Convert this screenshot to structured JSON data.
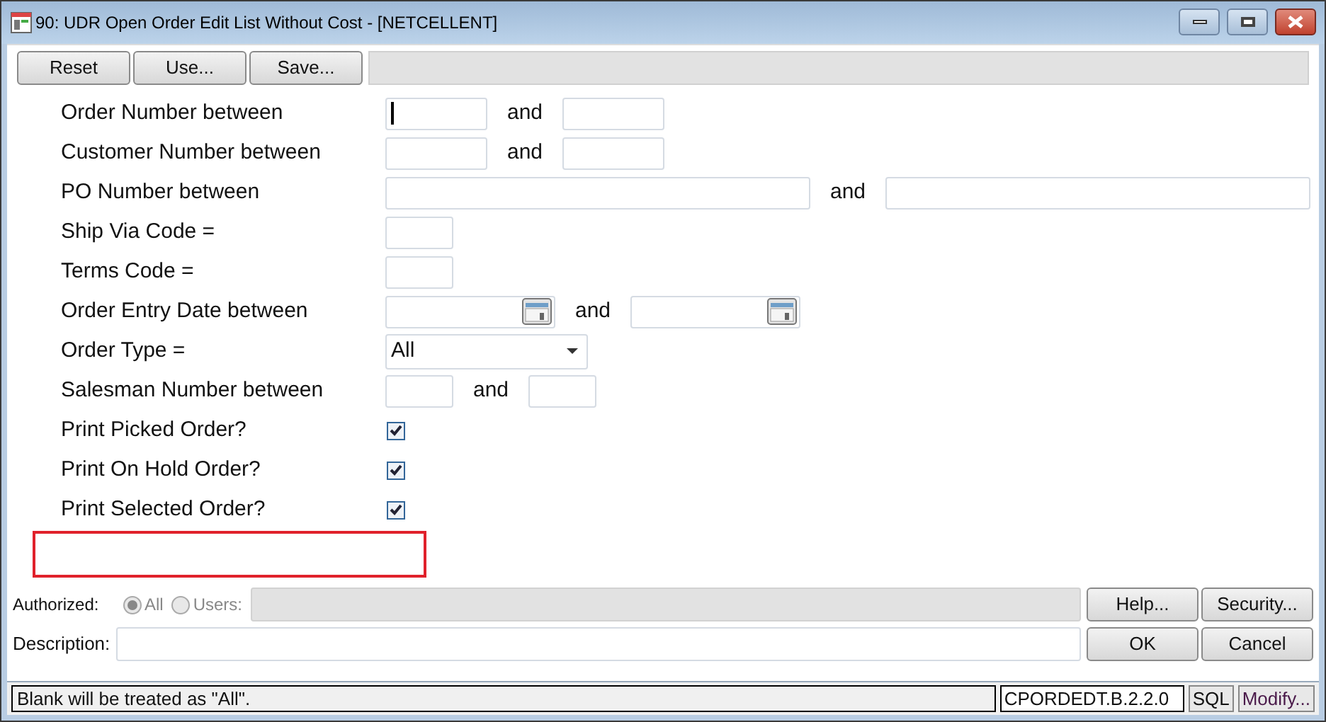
{
  "window": {
    "title": "90:  UDR Open Order Edit List Without Cost - [NETCELLENT]"
  },
  "toolbar": {
    "buttons": [
      "Reset",
      "Use...",
      "Save..."
    ]
  },
  "criteria": [
    {
      "kind": "range",
      "label": "Order Number between",
      "joiner": "and",
      "focused": true
    },
    {
      "kind": "range",
      "label": "Customer Number between",
      "joiner": "and",
      "focused": false
    },
    {
      "kind": "wide_range",
      "label": "PO Number between",
      "joiner": "and",
      "focused": false
    },
    {
      "kind": "single",
      "label": "Ship Via Code ="
    },
    {
      "kind": "single",
      "label": "Terms Code ="
    },
    {
      "kind": "date_range",
      "label": "Order Entry Date between",
      "joiner": "and"
    },
    {
      "kind": "select",
      "label": "Order Type =",
      "value": "All"
    },
    {
      "kind": "short_range",
      "label": "Salesman Number between",
      "joiner": "and",
      "focused": false
    },
    {
      "kind": "check",
      "label": "Print Picked Order?",
      "checked": true
    },
    {
      "kind": "check",
      "label": "Print On Hold Order?",
      "checked": true
    },
    {
      "kind": "check",
      "label": "Print Selected Order?",
      "checked": true
    }
  ],
  "authorized": {
    "label": "Authorized:",
    "options": [
      {
        "label": "All",
        "selected": true
      },
      {
        "label": "Users:",
        "selected": false
      }
    ]
  },
  "description": {
    "label": "Description:"
  },
  "buttons": {
    "help": "Help...",
    "security": "Security...",
    "ok": "OK",
    "cancel": "Cancel"
  },
  "status_bar": {
    "message": "Blank will be treated as \"All\".",
    "code": "CPORDEDT.B.2.2.0",
    "sql": "SQL",
    "modify": "Modify..."
  }
}
